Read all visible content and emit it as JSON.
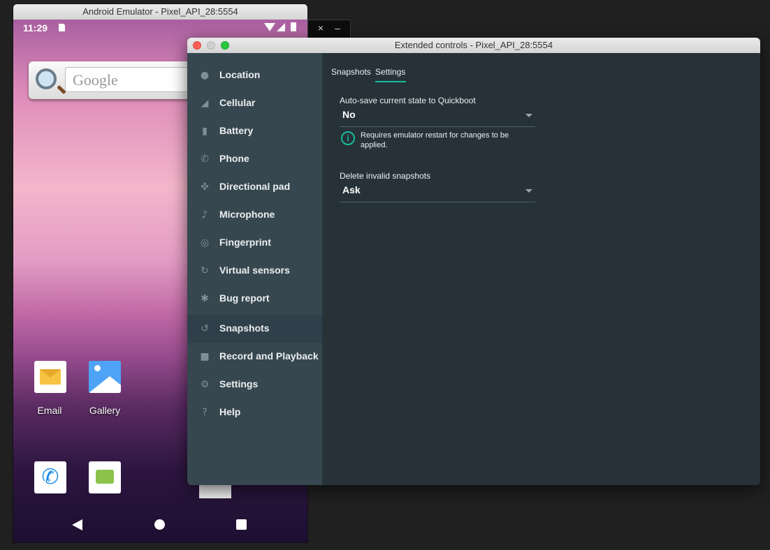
{
  "emulator": {
    "title": "Android Emulator - Pixel_API_28:5554",
    "status_time": "11:29",
    "search_placeholder": "Google",
    "apps": [
      {
        "label": "Email"
      },
      {
        "label": "Gallery"
      }
    ]
  },
  "emulator_toolbar": {
    "close_label": "×",
    "minimize_label": "–"
  },
  "extended_controls": {
    "title": "Extended controls - Pixel_API_28:5554",
    "sidebar": {
      "items": [
        {
          "label": "Location",
          "icon": "location-pin-icon",
          "glyph": "●"
        },
        {
          "label": "Cellular",
          "icon": "cellular-signal-icon",
          "glyph": "◢"
        },
        {
          "label": "Battery",
          "icon": "battery-icon",
          "glyph": "▮"
        },
        {
          "label": "Phone",
          "icon": "phone-icon",
          "glyph": "✆"
        },
        {
          "label": "Directional pad",
          "icon": "dpad-icon",
          "glyph": "✜"
        },
        {
          "label": "Microphone",
          "icon": "microphone-icon",
          "glyph": "♪"
        },
        {
          "label": "Fingerprint",
          "icon": "fingerprint-icon",
          "glyph": "◎"
        },
        {
          "label": "Virtual sensors",
          "icon": "rotate-icon",
          "glyph": "↻"
        },
        {
          "label": "Bug report",
          "icon": "bug-icon",
          "glyph": "✱"
        },
        {
          "label": "Snapshots",
          "icon": "history-icon",
          "glyph": "↺"
        },
        {
          "label": "Record and Playback",
          "icon": "videocam-icon",
          "glyph": "■"
        },
        {
          "label": "Settings",
          "icon": "gear-icon",
          "glyph": "⚙"
        },
        {
          "label": "Help",
          "icon": "help-icon",
          "glyph": "?"
        }
      ],
      "selected": "Snapshots"
    },
    "tabs": [
      {
        "label": "Snapshots"
      },
      {
        "label": "Settings"
      }
    ],
    "active_tab": "Settings",
    "accent_color": "#1abc9c",
    "settings": {
      "autosave_label": "Auto-save current state to Quickboot",
      "autosave_value": "No",
      "restart_note": "Requires emulator restart for changes to be applied.",
      "delete_label": "Delete invalid snapshots",
      "delete_value": "Ask"
    }
  }
}
